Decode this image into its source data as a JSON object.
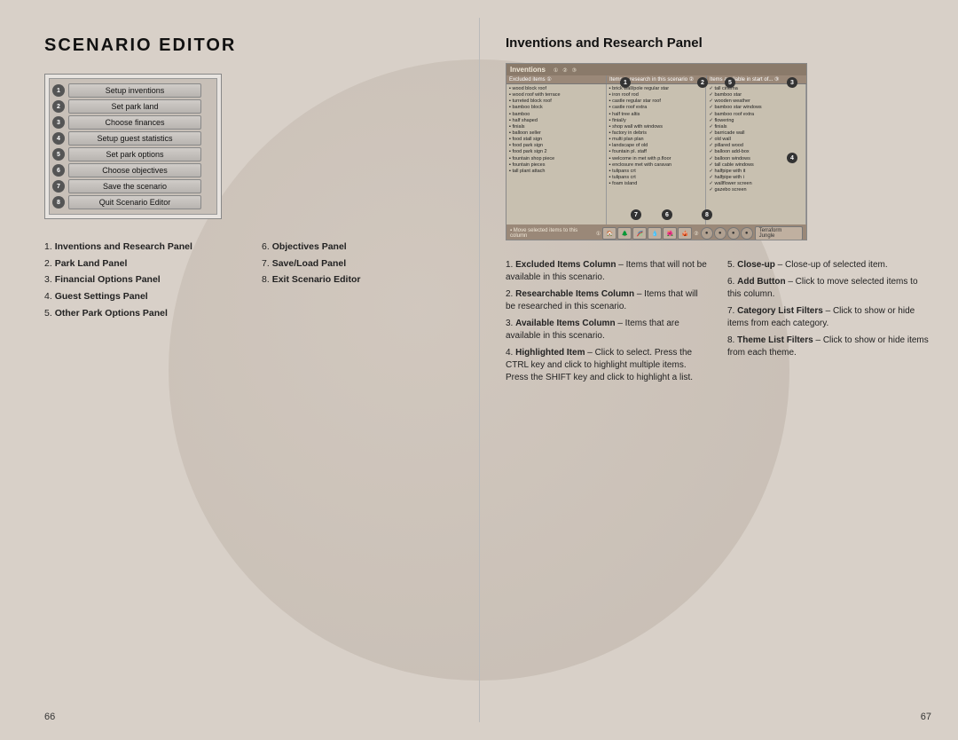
{
  "left": {
    "title": "SCENARIO EDITOR",
    "menu_items": [
      {
        "num": "1",
        "label": "Setup inventions"
      },
      {
        "num": "2",
        "label": "Set park land"
      },
      {
        "num": "3",
        "label": "Choose finances"
      },
      {
        "num": "4",
        "label": "Setup guest statistics"
      },
      {
        "num": "5",
        "label": "Set park options"
      },
      {
        "num": "6",
        "label": "Choose objectives"
      },
      {
        "num": "7",
        "label": "Save the scenario"
      },
      {
        "num": "8",
        "label": "Quit Scenario Editor"
      }
    ],
    "list_left": [
      {
        "num": "1.",
        "label": "Inventions and Research Panel"
      },
      {
        "num": "2.",
        "label": "Park Land Panel"
      },
      {
        "num": "3.",
        "label": "Financial Options Panel"
      },
      {
        "num": "4.",
        "label": "Guest Settings Panel"
      },
      {
        "num": "5.",
        "label": "Other Park Options Panel"
      }
    ],
    "list_right": [
      {
        "num": "6.",
        "label": "Objectives Panel"
      },
      {
        "num": "7.",
        "label": "Save/Load Panel"
      },
      {
        "num": "8.",
        "label": "Exit Scenario Editor"
      }
    ],
    "page_num": "66"
  },
  "right": {
    "title": "Inventions and Research Panel",
    "image_label": "Inventions",
    "col_headers": [
      "Excluded Items",
      "Researchable Items",
      "Available Items"
    ],
    "numbered_labels": [
      "1",
      "2",
      "3",
      "4",
      "5",
      "6",
      "7",
      "8"
    ],
    "list_left": [
      {
        "num": "1.",
        "bold_text": "Excluded Items Column",
        "dash": " – ",
        "text": "Items that will not be available in this scenario."
      },
      {
        "num": "2.",
        "bold_text": "Researchable Items Column",
        "dash": " – ",
        "text": "Items that will be researched in this scenario."
      },
      {
        "num": "3.",
        "bold_text": "Available Items Column",
        "dash": " – ",
        "text": "Items that are available in this scenario."
      },
      {
        "num": "4.",
        "bold_text": "Highlighted Item",
        "dash": " – ",
        "text": "Click to select. Press the CTRL key and click to highlight multiple items. Press the SHIFT key and click to highlight a list."
      }
    ],
    "list_right": [
      {
        "num": "5.",
        "bold_text": "Close-up",
        "dash": " – ",
        "text": "Close-up of selected item."
      },
      {
        "num": "6.",
        "bold_text": "Add Button",
        "dash": " – ",
        "text": "Click to move selected items to this column."
      },
      {
        "num": "7.",
        "bold_text": "Category List Filters",
        "dash": " – ",
        "text": "Click to show or hide items from each category."
      },
      {
        "num": "8.",
        "bold_text": "Theme List Filters",
        "dash": " – ",
        "text": "Click to show or hide items from each theme."
      }
    ],
    "page_num": "67"
  }
}
